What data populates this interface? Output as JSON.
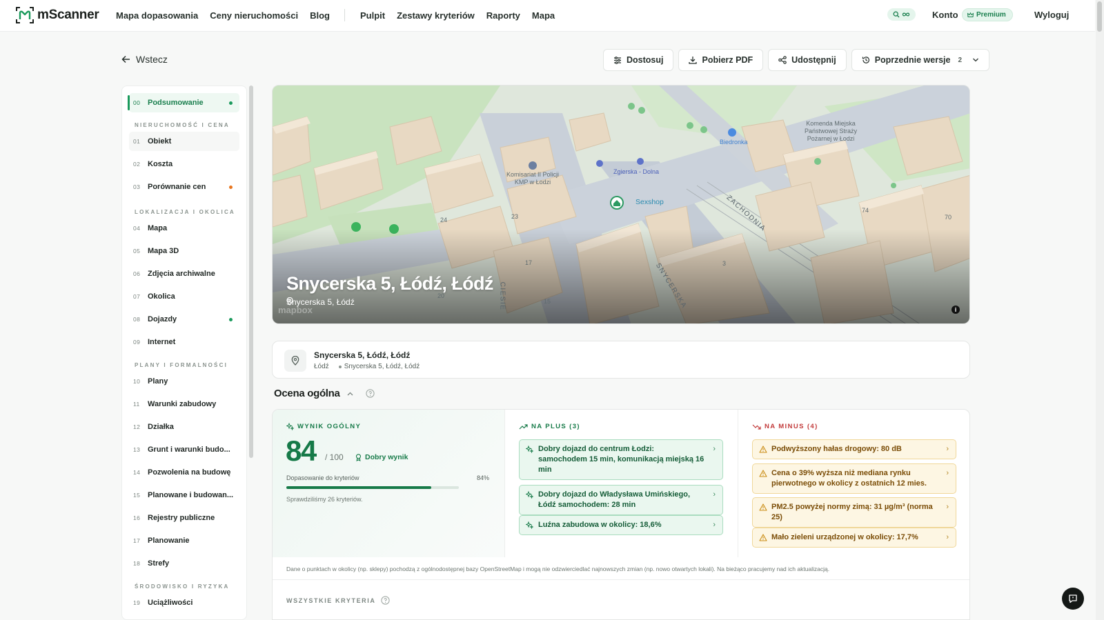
{
  "app": {
    "name": "mScanner"
  },
  "nav": {
    "links": [
      "Mapa dopasowania",
      "Ceny nieruchomości",
      "Blog"
    ],
    "links2": [
      "Pulpit",
      "Zestawy kryteriów",
      "Raporty",
      "Mapa"
    ],
    "account": "Konto",
    "premium": "Premium",
    "logout": "Wyloguj"
  },
  "toolbar": {
    "back": "Wstecz",
    "customize": "Dostosuj",
    "pdf": "Pobierz PDF",
    "share": "Udostępnij",
    "versions": "Poprzednie wersje",
    "versions_count": "2"
  },
  "sidebar": {
    "summary": {
      "num": "00",
      "label": "Podsumowanie"
    },
    "sections": [
      {
        "title": "NIERUCHOMOŚĆ I CENA",
        "items": [
          {
            "num": "01",
            "label": "Obiekt"
          },
          {
            "num": "02",
            "label": "Koszta"
          },
          {
            "num": "03",
            "label": "Porównanie cen"
          }
        ]
      },
      {
        "title": "LOKALIZACJA I OKOLICA",
        "items": [
          {
            "num": "04",
            "label": "Mapa"
          },
          {
            "num": "05",
            "label": "Mapa 3D"
          },
          {
            "num": "06",
            "label": "Zdjęcia archiwalne"
          },
          {
            "num": "07",
            "label": "Okolica"
          },
          {
            "num": "08",
            "label": "Dojazdy"
          },
          {
            "num": "09",
            "label": "Internet"
          }
        ]
      },
      {
        "title": "PLANY I FORMALNOŚCI",
        "items": [
          {
            "num": "10",
            "label": "Plany"
          },
          {
            "num": "11",
            "label": "Warunki zabudowy"
          },
          {
            "num": "12",
            "label": "Działka"
          },
          {
            "num": "13",
            "label": "Grunt i warunki budo..."
          },
          {
            "num": "14",
            "label": "Pozwolenia na budowę"
          },
          {
            "num": "15",
            "label": "Planowane i budowan..."
          },
          {
            "num": "16",
            "label": "Rejestry publiczne"
          },
          {
            "num": "17",
            "label": "Planowanie"
          },
          {
            "num": "18",
            "label": "Strefy"
          }
        ]
      },
      {
        "title": "ŚRODOWISKO I RYZYKA",
        "items": [
          {
            "num": "19",
            "label": "Uciążliwości"
          }
        ]
      }
    ]
  },
  "hero": {
    "title": "Snycerska 5, Łódź, Łódź",
    "subtitle": "Snycerska 5, Łódź",
    "attribution": "mapbox",
    "map_labels": {
      "police": "Komisariat II Policji KMP w Łodzi",
      "stop": "Zgierska - Dolna",
      "shop": "Sexshop",
      "store": "Biedronka",
      "fire": "Komenda Miejska Państwowej Straży Pożarnej w Łodzi",
      "street1": "ZACHODNIA",
      "street2": "SNYCERSKA",
      "street3": "CIESIE",
      "n24": "24",
      "n23": "23",
      "n17": "17",
      "n20": "20",
      "n15": "15",
      "n3": "3",
      "n74": "74",
      "n70": "70"
    }
  },
  "address": {
    "title": "Snycerska 5, Łódź, Łódź",
    "city": "Łódź",
    "full": "Snycerska 5, Łódź, Łódź"
  },
  "ocena": {
    "title": "Ocena ogólna",
    "score_head": "WYNIK OGÓLNY",
    "score": "84",
    "score_max": "/ 100",
    "badge": "Dobry wynik",
    "fit_label": "Dopasowanie do kryteriów",
    "fit_pct": "84%",
    "fit_value": 84,
    "checked": "Sprawdziliśmy 26 kryteriów.",
    "plus_head": "NA PLUS (3)",
    "plus": [
      "Dobry dojazd do centrum Łodzi: samochodem 15 min, komunikacją miejską 16 min",
      "Dobry dojazd do Władysława Umińskiego, Łódź samochodem: 28 min",
      "Luźna zabudowa w okolicy: 18,6%"
    ],
    "minus_head": "NA MINUS (4)",
    "minus": [
      "Podwyższony hałas drogowy: 80 dB",
      "Cena o 39% wyższa niż mediana rynku pierwotnego w okolicy z ostatnich 12 mies.",
      "PM2.5 powyżej normy zimą: 31 µg/m³ (norma 25)",
      "Mało zieleni urządzonej w okolicy: 17,7%"
    ],
    "disclaimer": "Dane o punktach w okolicy (np. sklepy) pochodzą z ogólnodostępnej bazy OpenStreetMap i mogą nie odzwierciedlać najnowszych zmian (np. nowo otwartych lokali). Na bieżąco pracujemy nad ich aktualizacją.",
    "all_criteria": "WSZYSTKIE KRYTERIA"
  },
  "colors": {
    "brand": "#167a48",
    "plus_bg": "#eaf7ef",
    "minus_bg": "#fdf6e3",
    "orange_dot": "#e8761f"
  }
}
